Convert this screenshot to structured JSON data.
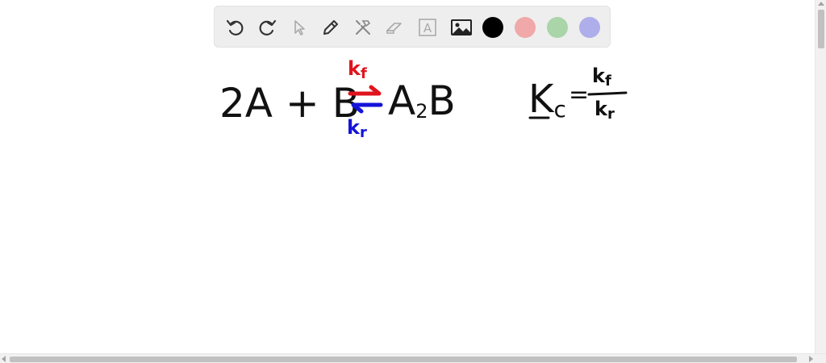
{
  "toolbar": {
    "tools": [
      {
        "name": "undo-icon"
      },
      {
        "name": "redo-icon"
      },
      {
        "name": "select-pointer-icon"
      },
      {
        "name": "pen-icon"
      },
      {
        "name": "tools-icon"
      },
      {
        "name": "eraser-icon"
      },
      {
        "name": "text-box-icon",
        "glyph": "A"
      },
      {
        "name": "image-icon"
      }
    ],
    "colors": [
      "#000000",
      "#f1a8a8",
      "#a9d5a9",
      "#adaeea"
    ]
  },
  "canvas": {
    "equation": {
      "reactants": "2A + B",
      "forward_rate": "k",
      "forward_sub": "f",
      "reverse_rate": "k",
      "reverse_sub": "r",
      "product_main": "A",
      "product_sub": "2",
      "product_tail": "B",
      "forward_color": "#e0141e",
      "reverse_color": "#1414d8"
    },
    "kc_expression": {
      "lhs_main": "K",
      "lhs_sub": "c",
      "equals": "=",
      "numerator_main": "k",
      "numerator_sub": "f",
      "denominator_main": "k",
      "denominator_sub": "r"
    }
  }
}
